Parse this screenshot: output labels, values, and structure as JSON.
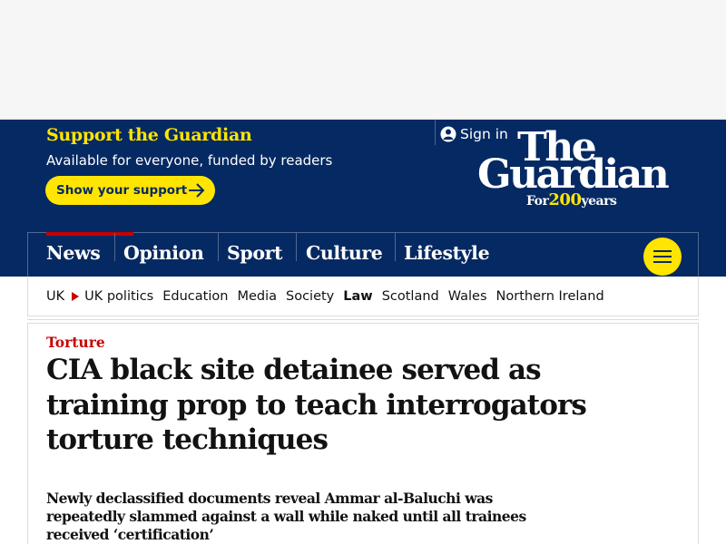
{
  "masthead": {
    "support_title": "Support the Guardian",
    "support_subtitle": "Available for everyone, funded by readers",
    "support_button": "Show your support",
    "sign_in": "Sign in",
    "logo": {
      "line1": "The",
      "line2": "Guardian",
      "tagline_prefix": "For",
      "tagline_number": "200",
      "tagline_suffix": "years"
    },
    "colors": {
      "brand_blue": "#052962",
      "accent_yellow": "#ffe500",
      "news_red": "#c70000"
    }
  },
  "pillars": [
    {
      "label": "News",
      "active": true
    },
    {
      "label": "Opinion",
      "active": false
    },
    {
      "label": "Sport",
      "active": false
    },
    {
      "label": "Culture",
      "active": false
    },
    {
      "label": "Lifestyle",
      "active": false
    }
  ],
  "subnav": {
    "items": [
      "UK",
      "UK politics",
      "Education",
      "Media",
      "Society",
      "Law",
      "Scotland",
      "Wales",
      "Northern Ireland"
    ],
    "current": "Law"
  },
  "article": {
    "kicker": "Torture",
    "headline": "CIA black site detainee served as training prop to teach interrogators torture techniques",
    "standfirst": "Newly declassified documents reveal Ammar al-Baluchi was repeatedly slammed against a wall while naked until all trainees received ‘certification’"
  }
}
